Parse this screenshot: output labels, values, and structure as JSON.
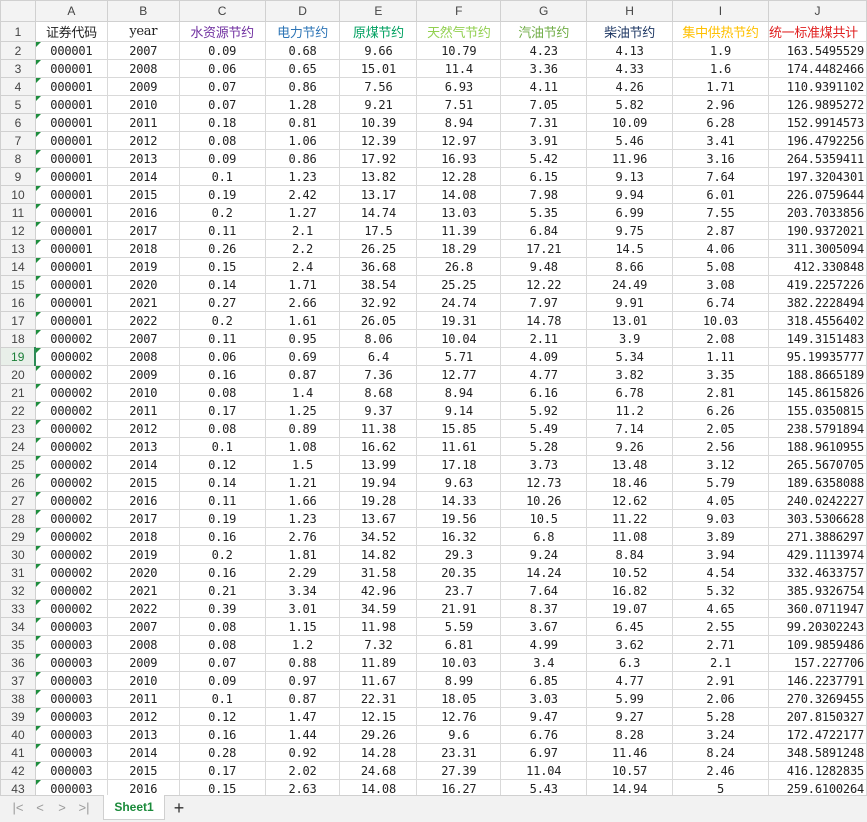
{
  "columns": [
    "A",
    "B",
    "C",
    "D",
    "E",
    "F",
    "G",
    "H",
    "I",
    "J"
  ],
  "header_row": {
    "row": "1",
    "cells": [
      {
        "text": "证券代码",
        "color": "#222222"
      },
      {
        "text": "year",
        "color": "#222222"
      },
      {
        "text": "水资源节约",
        "color": "#7030a0"
      },
      {
        "text": "电力节约",
        "color": "#2e75b6"
      },
      {
        "text": "原煤节约",
        "color": "#00a060"
      },
      {
        "text": "天然气节约",
        "color": "#92d050"
      },
      {
        "text": "汽油节约",
        "color": "#70ad47"
      },
      {
        "text": "柴油节约",
        "color": "#1f3864"
      },
      {
        "text": "集中供热节约",
        "color": "#ffc000"
      },
      {
        "text": "统一标准煤共计",
        "color": "#e02020"
      }
    ]
  },
  "rows": [
    [
      "2",
      "000001",
      "2007",
      "0.09",
      "0.68",
      "9.66",
      "10.79",
      "4.23",
      "4.13",
      "1.9",
      "163.5495529"
    ],
    [
      "3",
      "000001",
      "2008",
      "0.06",
      "0.65",
      "15.01",
      "11.4",
      "3.36",
      "4.33",
      "1.6",
      "174.4482466"
    ],
    [
      "4",
      "000001",
      "2009",
      "0.07",
      "0.86",
      "7.56",
      "6.93",
      "4.11",
      "4.26",
      "1.71",
      "110.9391102"
    ],
    [
      "5",
      "000001",
      "2010",
      "0.07",
      "1.28",
      "9.21",
      "7.51",
      "7.05",
      "5.82",
      "2.96",
      "126.9895272"
    ],
    [
      "6",
      "000001",
      "2011",
      "0.18",
      "0.81",
      "10.39",
      "8.94",
      "7.31",
      "10.09",
      "6.28",
      "152.9914573"
    ],
    [
      "7",
      "000001",
      "2012",
      "0.08",
      "1.06",
      "12.39",
      "12.97",
      "3.91",
      "5.46",
      "3.41",
      "196.4792256"
    ],
    [
      "8",
      "000001",
      "2013",
      "0.09",
      "0.86",
      "17.92",
      "16.93",
      "5.42",
      "11.96",
      "3.16",
      "264.5359411"
    ],
    [
      "9",
      "000001",
      "2014",
      "0.1",
      "1.23",
      "13.82",
      "12.28",
      "6.15",
      "9.13",
      "7.64",
      "197.3204301"
    ],
    [
      "10",
      "000001",
      "2015",
      "0.19",
      "2.42",
      "13.17",
      "14.08",
      "7.98",
      "9.94",
      "6.01",
      "226.0759644"
    ],
    [
      "11",
      "000001",
      "2016",
      "0.2",
      "1.27",
      "14.74",
      "13.03",
      "5.35",
      "6.99",
      "7.55",
      "203.7033856"
    ],
    [
      "12",
      "000001",
      "2017",
      "0.11",
      "2.1",
      "17.5",
      "11.39",
      "6.84",
      "9.75",
      "2.87",
      "190.9372021"
    ],
    [
      "13",
      "000001",
      "2018",
      "0.26",
      "2.2",
      "26.25",
      "18.29",
      "17.21",
      "14.5",
      "4.06",
      "311.3005094"
    ],
    [
      "14",
      "000001",
      "2019",
      "0.15",
      "2.4",
      "36.68",
      "26.8",
      "9.48",
      "8.66",
      "5.08",
      "412.330848"
    ],
    [
      "15",
      "000001",
      "2020",
      "0.14",
      "1.71",
      "38.54",
      "25.25",
      "12.22",
      "24.49",
      "3.08",
      "419.2257226"
    ],
    [
      "16",
      "000001",
      "2021",
      "0.27",
      "2.66",
      "32.92",
      "24.74",
      "7.97",
      "9.91",
      "6.74",
      "382.2228494"
    ],
    [
      "17",
      "000001",
      "2022",
      "0.2",
      "1.61",
      "26.05",
      "19.31",
      "14.78",
      "13.01",
      "10.03",
      "318.4556402"
    ],
    [
      "18",
      "000002",
      "2007",
      "0.11",
      "0.95",
      "8.06",
      "10.04",
      "2.11",
      "3.9",
      "2.08",
      "149.3151483"
    ],
    [
      "19",
      "000002",
      "2008",
      "0.06",
      "0.69",
      "6.4",
      "5.71",
      "4.09",
      "5.34",
      "1.11",
      "95.19935777"
    ],
    [
      "20",
      "000002",
      "2009",
      "0.16",
      "0.87",
      "7.36",
      "12.77",
      "4.77",
      "3.82",
      "3.35",
      "188.8665189"
    ],
    [
      "21",
      "000002",
      "2010",
      "0.08",
      "1.4",
      "8.68",
      "8.94",
      "6.16",
      "6.78",
      "2.81",
      "145.8615826"
    ],
    [
      "22",
      "000002",
      "2011",
      "0.17",
      "1.25",
      "9.37",
      "9.14",
      "5.92",
      "11.2",
      "6.26",
      "155.0350815"
    ],
    [
      "23",
      "000002",
      "2012",
      "0.08",
      "0.89",
      "11.38",
      "15.85",
      "5.49",
      "7.14",
      "2.05",
      "238.5791894"
    ],
    [
      "24",
      "000002",
      "2013",
      "0.1",
      "1.08",
      "16.62",
      "11.61",
      "5.28",
      "9.26",
      "2.56",
      "188.9610955"
    ],
    [
      "25",
      "000002",
      "2014",
      "0.12",
      "1.5",
      "13.99",
      "17.18",
      "3.73",
      "13.48",
      "3.12",
      "265.5670705"
    ],
    [
      "26",
      "000002",
      "2015",
      "0.14",
      "1.21",
      "19.94",
      "9.63",
      "12.73",
      "18.46",
      "5.79",
      "189.6358088"
    ],
    [
      "27",
      "000002",
      "2016",
      "0.11",
      "1.66",
      "19.28",
      "14.33",
      "10.26",
      "12.62",
      "4.05",
      "240.0242227"
    ],
    [
      "28",
      "000002",
      "2017",
      "0.19",
      "1.23",
      "13.67",
      "19.56",
      "10.5",
      "11.22",
      "9.03",
      "303.5306628"
    ],
    [
      "29",
      "000002",
      "2018",
      "0.16",
      "2.76",
      "34.52",
      "16.32",
      "6.8",
      "11.08",
      "3.89",
      "271.3886297"
    ],
    [
      "30",
      "000002",
      "2019",
      "0.2",
      "1.81",
      "14.82",
      "29.3",
      "9.24",
      "8.84",
      "3.94",
      "429.1113974"
    ],
    [
      "31",
      "000002",
      "2020",
      "0.16",
      "2.29",
      "31.58",
      "20.35",
      "14.24",
      "10.52",
      "4.54",
      "332.4633757"
    ],
    [
      "32",
      "000002",
      "2021",
      "0.21",
      "3.34",
      "42.96",
      "23.7",
      "7.64",
      "16.82",
      "5.32",
      "385.9326754"
    ],
    [
      "33",
      "000002",
      "2022",
      "0.39",
      "3.01",
      "34.59",
      "21.91",
      "8.37",
      "19.07",
      "4.65",
      "360.0711947"
    ],
    [
      "34",
      "000003",
      "2007",
      "0.08",
      "1.15",
      "11.98",
      "5.59",
      "3.67",
      "6.45",
      "2.55",
      "99.20302243"
    ],
    [
      "35",
      "000003",
      "2008",
      "0.08",
      "1.2",
      "7.32",
      "6.81",
      "4.99",
      "3.62",
      "2.71",
      "109.9859486"
    ],
    [
      "36",
      "000003",
      "2009",
      "0.07",
      "0.88",
      "11.89",
      "10.03",
      "3.4",
      "6.3",
      "2.1",
      "157.227706"
    ],
    [
      "37",
      "000003",
      "2010",
      "0.09",
      "0.97",
      "11.67",
      "8.99",
      "6.85",
      "4.77",
      "2.91",
      "146.2237791"
    ],
    [
      "38",
      "000003",
      "2011",
      "0.1",
      "0.87",
      "22.31",
      "18.05",
      "3.03",
      "5.99",
      "2.06",
      "270.3269455"
    ],
    [
      "39",
      "000003",
      "2012",
      "0.12",
      "1.47",
      "12.15",
      "12.76",
      "9.47",
      "9.27",
      "5.28",
      "207.8150327"
    ],
    [
      "40",
      "000003",
      "2013",
      "0.16",
      "1.44",
      "29.26",
      "9.6",
      "6.76",
      "8.28",
      "3.24",
      "172.4722177"
    ],
    [
      "41",
      "000003",
      "2014",
      "0.28",
      "0.92",
      "14.28",
      "23.31",
      "6.97",
      "11.46",
      "8.24",
      "348.5891248"
    ],
    [
      "42",
      "000003",
      "2015",
      "0.17",
      "2.02",
      "24.68",
      "27.39",
      "11.04",
      "10.57",
      "2.46",
      "416.1282835"
    ],
    [
      "43",
      "000003",
      "2016",
      "0.15",
      "2.63",
      "14.08",
      "16.27",
      "5.43",
      "14.94",
      "5",
      "259.6100264"
    ]
  ],
  "active_row": "19",
  "tabs": {
    "sheet_name": "Sheet1",
    "nav_first": "|<",
    "nav_prev": "<",
    "nav_next": ">",
    "nav_last": ">|",
    "add": "+"
  },
  "accent_color": "#1a8a3a"
}
